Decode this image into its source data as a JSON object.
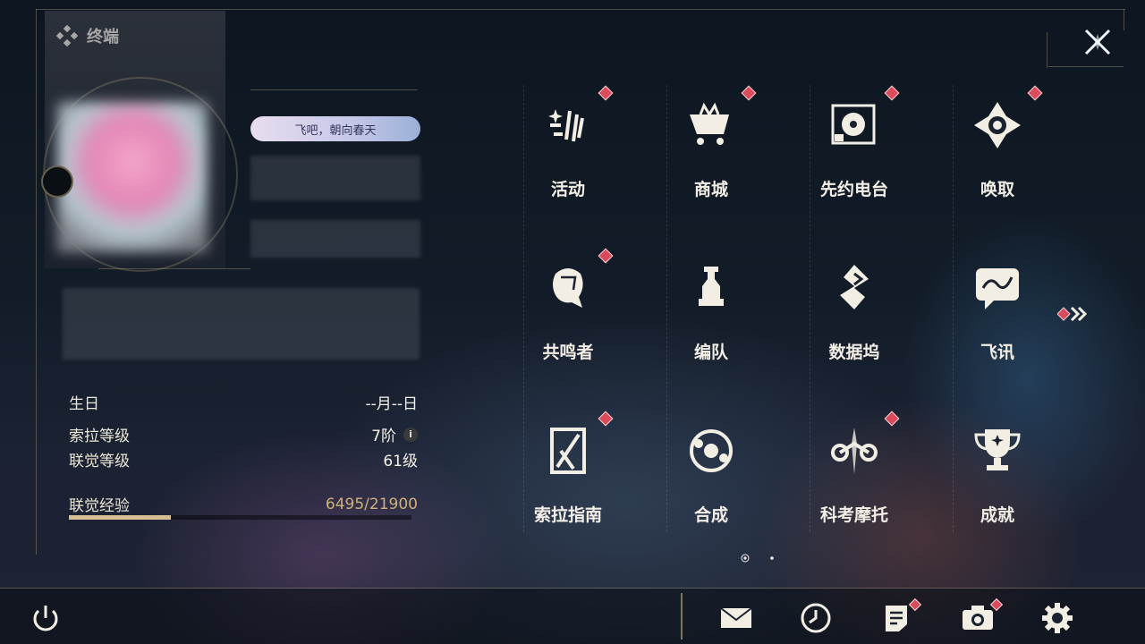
{
  "header": {
    "title": "终端",
    "title_icon": "diamond-cluster-icon",
    "close_icon": "close-x-icon"
  },
  "profile": {
    "title_badge": "飞吧，朝向春天",
    "stats": [
      {
        "label": "生日",
        "value": "--月--日"
      },
      {
        "label": "索拉等级",
        "value": "7阶"
      },
      {
        "label": "联觉等级",
        "value": "61级"
      }
    ],
    "exp": {
      "label": "联觉经验",
      "value": "6495/21900",
      "progress": 0.2966
    }
  },
  "menu": {
    "items": [
      {
        "label": "活动",
        "icon": "activity-icon",
        "badge": true
      },
      {
        "label": "商城",
        "icon": "shop-icon",
        "badge": true
      },
      {
        "label": "先约电台",
        "icon": "radio-icon",
        "badge": true
      },
      {
        "label": "唤取",
        "icon": "convene-icon",
        "badge": true
      },
      {
        "label": "共鸣者",
        "icon": "resonator-icon",
        "badge": true
      },
      {
        "label": "编队",
        "icon": "team-chess-icon",
        "badge": false
      },
      {
        "label": "数据坞",
        "icon": "data-bank-icon",
        "badge": false
      },
      {
        "label": "飞讯",
        "icon": "message-icon",
        "badge": false
      },
      {
        "label": "索拉指南",
        "icon": "guidebook-icon",
        "badge": true
      },
      {
        "label": "合成",
        "icon": "synthesis-icon",
        "badge": false
      },
      {
        "label": "科考摩托",
        "icon": "motorbike-icon",
        "badge": true
      },
      {
        "label": "成就",
        "icon": "trophy-icon",
        "badge": false
      }
    ],
    "next_icon": "double-chevron-right-icon",
    "page_count": 2,
    "current_page": 1
  },
  "bottom_bar": {
    "power_icon": "power-icon",
    "icons": [
      "mail-icon",
      "clock-icon",
      "notes-icon",
      "camera-icon",
      "settings-gear-icon"
    ]
  },
  "colors": {
    "badge": "#d94a5b",
    "accent_gold": "#cdb17b",
    "text": "#f2eee4"
  }
}
